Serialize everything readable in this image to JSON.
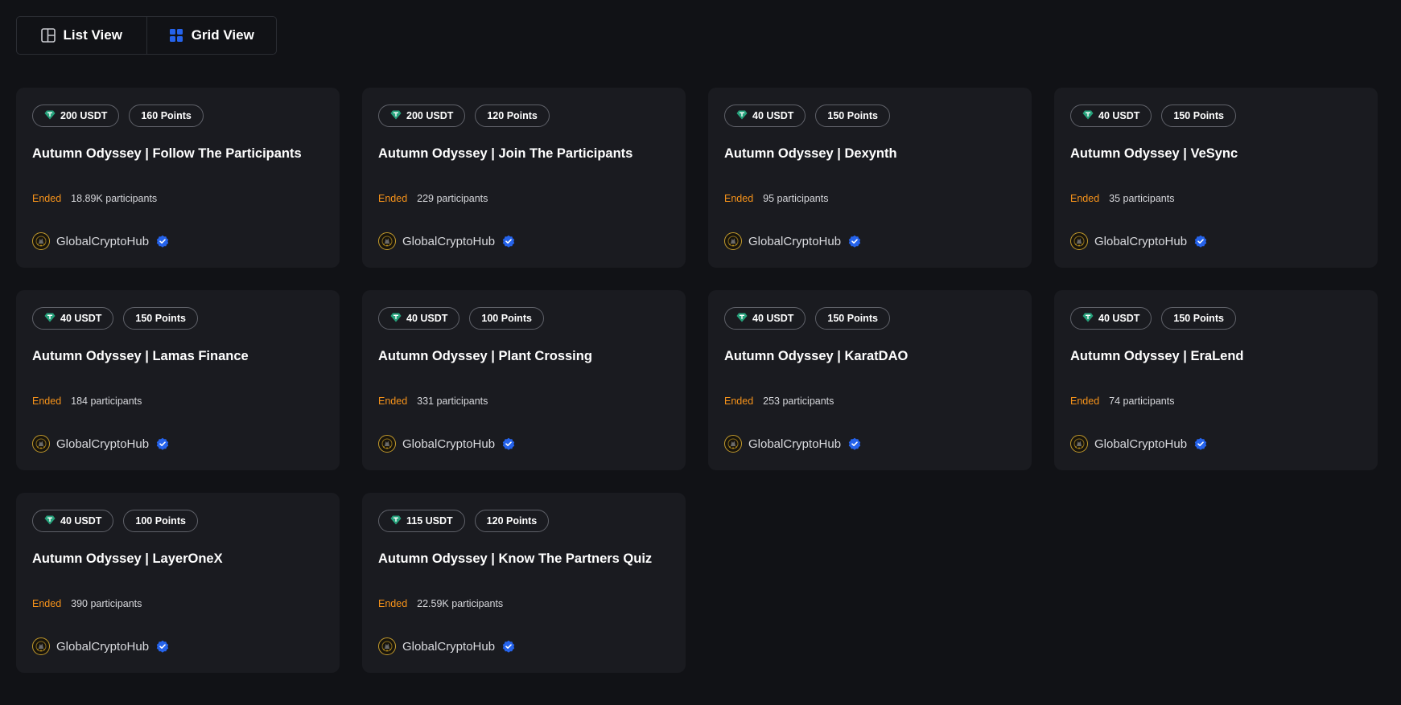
{
  "toolbar": {
    "list_view_label": "List View",
    "grid_view_label": "Grid View",
    "active": "grid"
  },
  "colors": {
    "background": "#111216",
    "card": "#1a1b20",
    "status_ended": "#f7931a",
    "verified_blue": "#2563eb",
    "usdt_teal": "#26a17b"
  },
  "icons": {
    "list_view": "list-view-icon",
    "grid_view": "grid-view-icon",
    "reward": "usdt-icon",
    "verified": "verified-badge-icon",
    "avatar": "org-avatar"
  },
  "campaigns": [
    {
      "reward": "200 USDT",
      "points": "160 Points",
      "title": "Autumn Odyssey | Follow The Participants",
      "status": "Ended",
      "participants": "18.89K participants",
      "org": "GlobalCryptoHub"
    },
    {
      "reward": "200 USDT",
      "points": "120 Points",
      "title": "Autumn Odyssey | Join The Participants",
      "status": "Ended",
      "participants": "229 participants",
      "org": "GlobalCryptoHub"
    },
    {
      "reward": "40 USDT",
      "points": "150 Points",
      "title": "Autumn Odyssey | Dexynth",
      "status": "Ended",
      "participants": "95 participants",
      "org": "GlobalCryptoHub"
    },
    {
      "reward": "40 USDT",
      "points": "150 Points",
      "title": "Autumn Odyssey | VeSync",
      "status": "Ended",
      "participants": "35 participants",
      "org": "GlobalCryptoHub"
    },
    {
      "reward": "40 USDT",
      "points": "150 Points",
      "title": "Autumn Odyssey | Lamas Finance",
      "status": "Ended",
      "participants": "184 participants",
      "org": "GlobalCryptoHub"
    },
    {
      "reward": "40 USDT",
      "points": "100 Points",
      "title": "Autumn Odyssey | Plant Crossing",
      "status": "Ended",
      "participants": "331 participants",
      "org": "GlobalCryptoHub"
    },
    {
      "reward": "40 USDT",
      "points": "150 Points",
      "title": "Autumn Odyssey | KaratDAO",
      "status": "Ended",
      "participants": "253 participants",
      "org": "GlobalCryptoHub"
    },
    {
      "reward": "40 USDT",
      "points": "150 Points",
      "title": "Autumn Odyssey | EraLend",
      "status": "Ended",
      "participants": "74 participants",
      "org": "GlobalCryptoHub"
    },
    {
      "reward": "40 USDT",
      "points": "100 Points",
      "title": "Autumn Odyssey | LayerOneX",
      "status": "Ended",
      "participants": "390 participants",
      "org": "GlobalCryptoHub"
    },
    {
      "reward": "115 USDT",
      "points": "120 Points",
      "title": "Autumn Odyssey | Know The Partners Quiz",
      "status": "Ended",
      "participants": "22.59K participants",
      "org": "GlobalCryptoHub"
    }
  ]
}
